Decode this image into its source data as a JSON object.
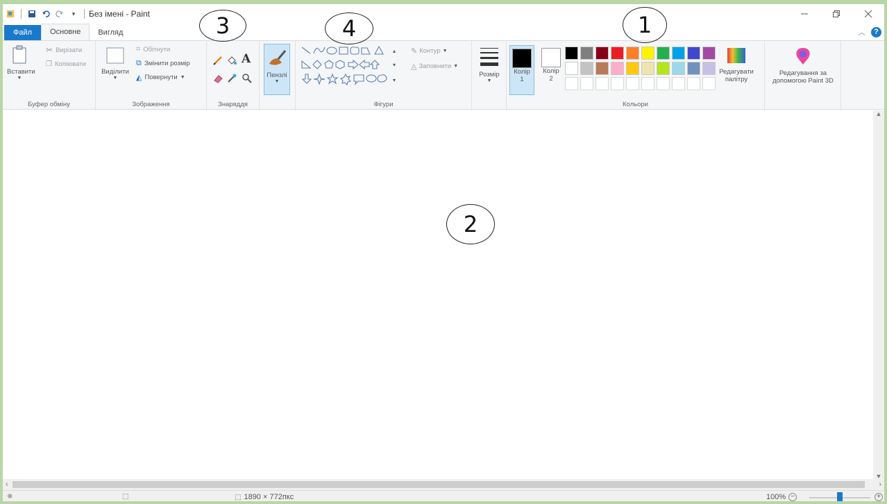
{
  "window": {
    "title": "Без імені - Paint",
    "quick_access_dropdown": "▾"
  },
  "tabs": [
    {
      "label": "Файл"
    },
    {
      "label": "Основне"
    },
    {
      "label": "Вигляд"
    }
  ],
  "clipboard": {
    "paste": "Вставити",
    "cut": "Вирізати",
    "copy": "Копіювати",
    "group": "Буфер обміну"
  },
  "image": {
    "select": "Виділити",
    "crop": "Обітнути",
    "resize": "Змінити розмір",
    "rotate": "Повернути",
    "group": "Зображення"
  },
  "tools": {
    "group": "Знаряддя",
    "text_tool": "A"
  },
  "brushes": {
    "label": "Пензлі"
  },
  "shapes": {
    "outline": "Контур",
    "fill": "Заповнити",
    "group": "Фігури"
  },
  "size": {
    "label": "Розмір"
  },
  "colors": {
    "color1": "Колір",
    "color1_index": "1",
    "color2": "Колір",
    "color2_index": "2",
    "edit_palette_1": "Редагувати",
    "edit_palette_2": "палітру",
    "group": "Кольори",
    "paint3d_1": "Редагування за",
    "paint3d_2": "допомогою Paint 3D",
    "palette_row1": [
      "#000000",
      "#7f7f7f",
      "#880015",
      "#ed1c24",
      "#ff7f27",
      "#fff200",
      "#22b14c",
      "#00a2e8",
      "#3f48cc",
      "#a349a4"
    ],
    "palette_row2": [
      "#ffffff",
      "#c3c3c3",
      "#b97a57",
      "#ffaec9",
      "#ffc90e",
      "#efe4b0",
      "#b5e61d",
      "#99d9ea",
      "#7092be",
      "#c8bfe7"
    ],
    "active_color1": "#000000",
    "active_color2": "#ffffff",
    "accent": "#1979ca"
  },
  "status": {
    "canvas_size": "1890 × 772пкс",
    "zoom": "100%"
  },
  "callouts": [
    "1",
    "2",
    "3",
    "4"
  ]
}
